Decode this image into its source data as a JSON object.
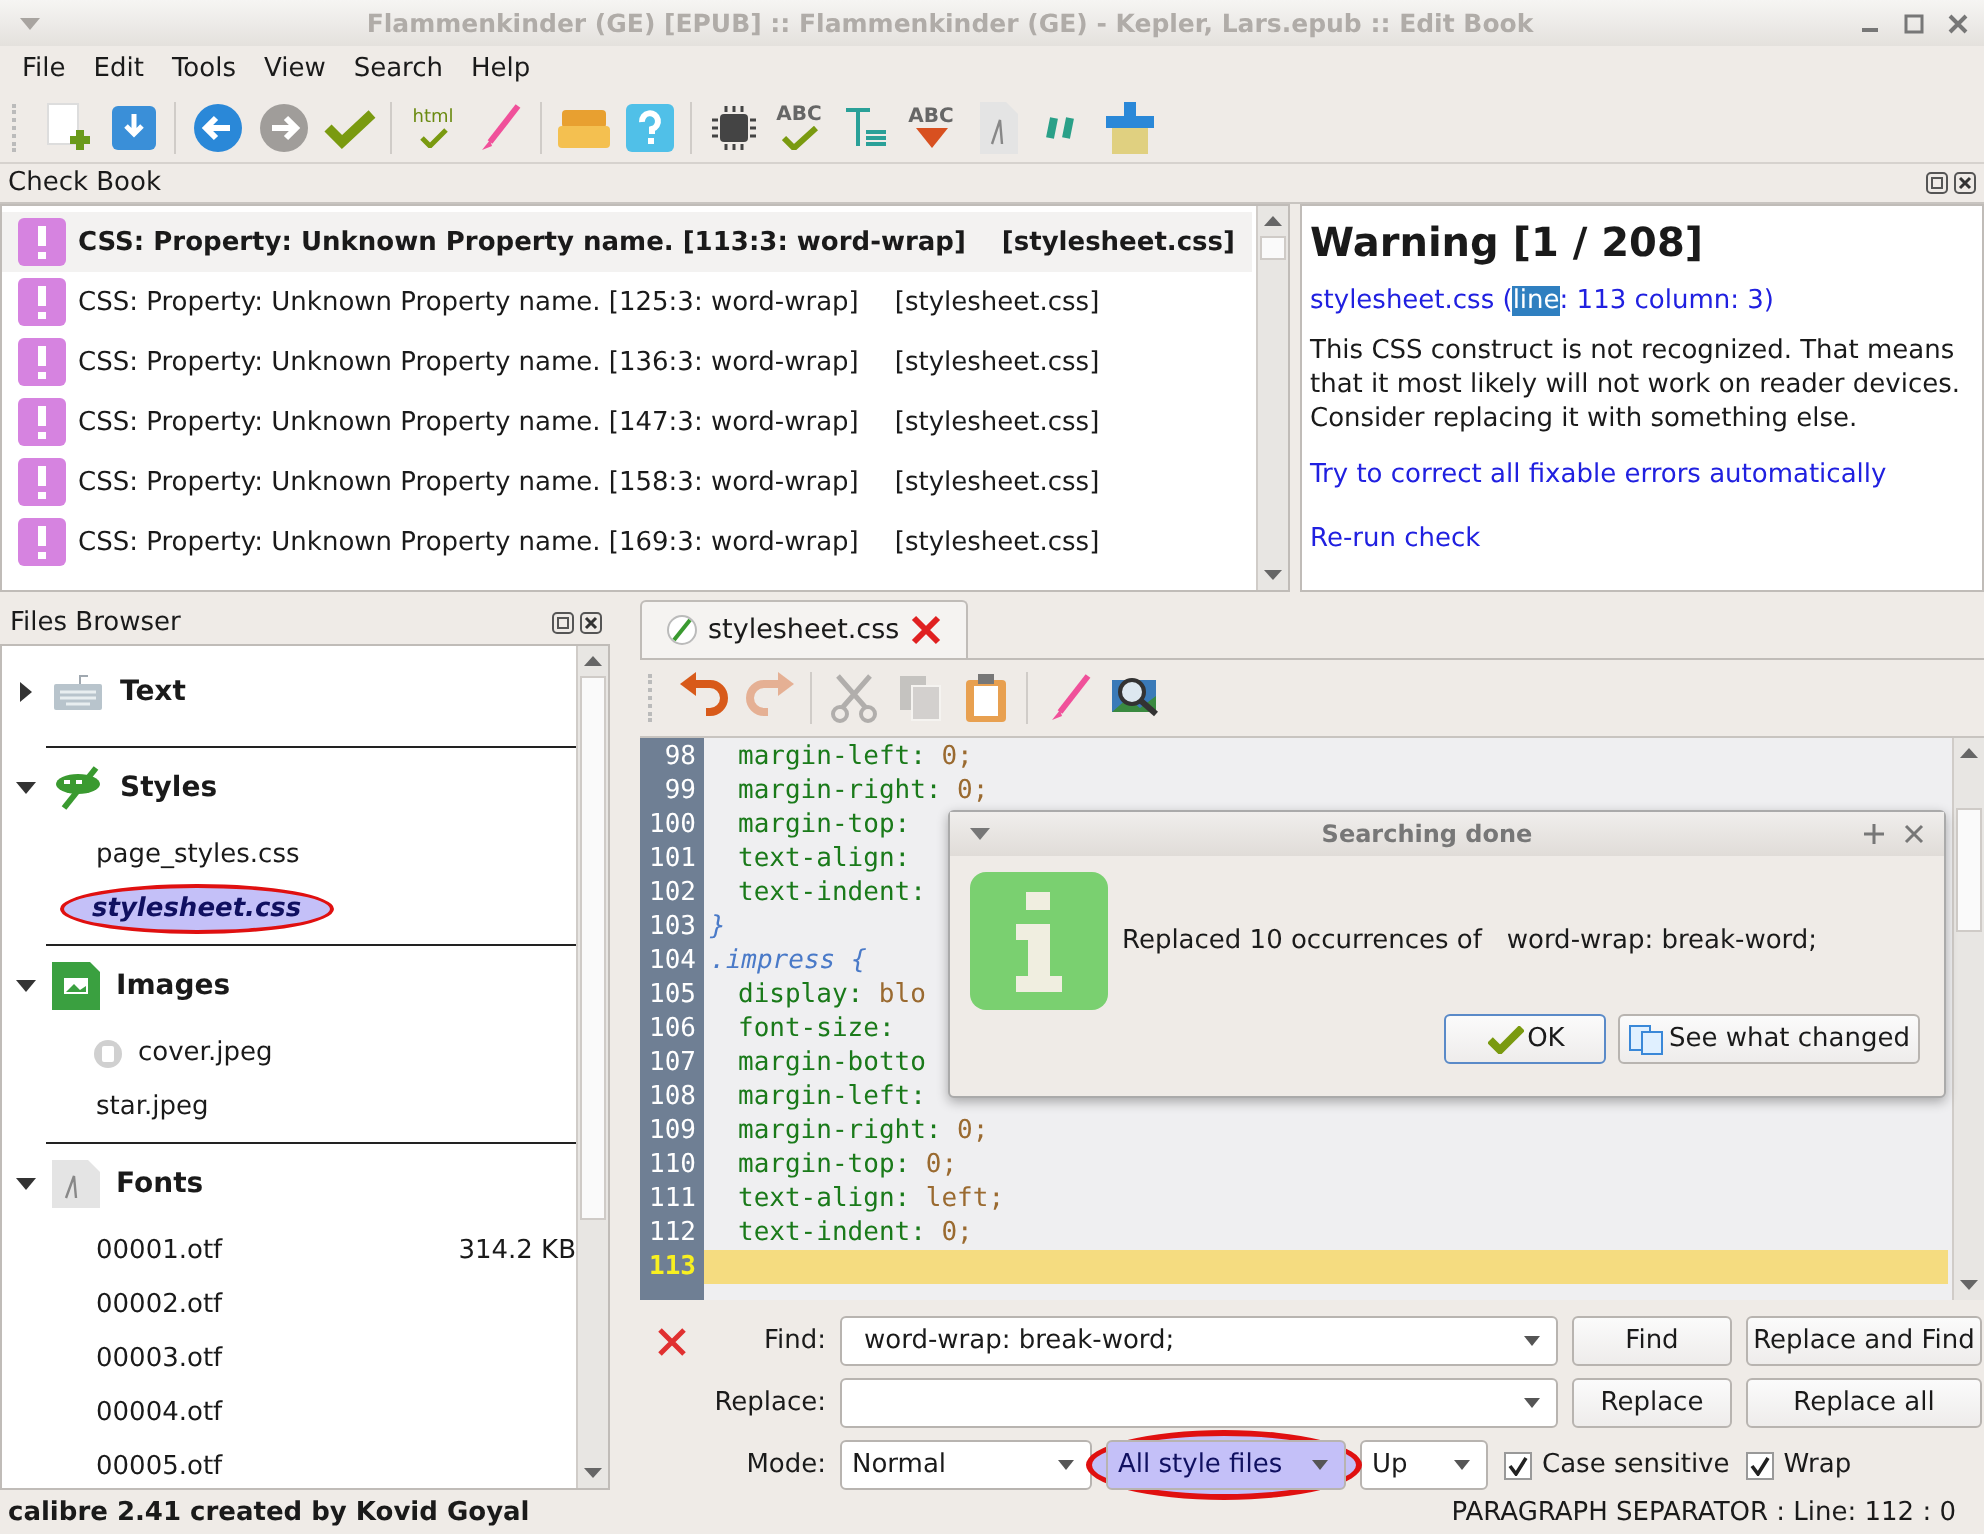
{
  "window": {
    "title": "Flammenkinder (GE) [EPUB] :: Flammenkinder (GE) - Kepler, Lars.epub :: Edit Book"
  },
  "menu": [
    "File",
    "Edit",
    "Tools",
    "View",
    "Search",
    "Help"
  ],
  "toolbar": [
    {
      "kind": "new-file"
    },
    {
      "kind": "save"
    },
    {
      "kind": "separator"
    },
    {
      "kind": "back"
    },
    {
      "kind": "forward"
    },
    {
      "kind": "check"
    },
    {
      "kind": "separator"
    },
    {
      "kind": "html-check",
      "text": "html"
    },
    {
      "kind": "brush"
    },
    {
      "kind": "separator"
    },
    {
      "kind": "box"
    },
    {
      "kind": "help"
    },
    {
      "kind": "separator"
    },
    {
      "kind": "chip"
    },
    {
      "kind": "spell-check",
      "text": "ABC"
    },
    {
      "kind": "text-format"
    },
    {
      "kind": "spell-replace",
      "text": "ABC"
    },
    {
      "kind": "font-doc"
    },
    {
      "kind": "quotes"
    },
    {
      "kind": "paint"
    }
  ],
  "check_book": {
    "title": "Check Book",
    "items": [
      {
        "message": "CSS: Property: Unknown Property name. [113:3: word-wrap]",
        "file": "[stylesheet.css]",
        "selected": true
      },
      {
        "message": "CSS: Property: Unknown Property name. [125:3: word-wrap]",
        "file": "[stylesheet.css]",
        "selected": false
      },
      {
        "message": "CSS: Property: Unknown Property name. [136:3: word-wrap]",
        "file": "[stylesheet.css]",
        "selected": false
      },
      {
        "message": "CSS: Property: Unknown Property name. [147:3: word-wrap]",
        "file": "[stylesheet.css]",
        "selected": false
      },
      {
        "message": "CSS: Property: Unknown Property name. [158:3: word-wrap]",
        "file": "[stylesheet.css]",
        "selected": false
      },
      {
        "message": "CSS: Property: Unknown Property name. [169:3: word-wrap]",
        "file": "[stylesheet.css]",
        "selected": false
      }
    ],
    "details": {
      "title": "Warning [1 / 208]",
      "location": {
        "before": "stylesheet.css (",
        "highlight": "line",
        "after": ": 113 column: 3)"
      },
      "description": "This CSS construct is not recognized. That means that it most likely will not work on reader devices. Consider replacing it with something else.",
      "links": [
        "Try to correct all fixable errors automatically",
        "Re-run check"
      ]
    }
  },
  "files_browser": {
    "title": "Files Browser",
    "sections": [
      {
        "name": "Text",
        "kind": "keyboard",
        "expanded": false
      },
      {
        "name": "Styles",
        "kind": "styles",
        "expanded": true,
        "children": [
          {
            "name": "page_styles.css",
            "selected": false
          },
          {
            "name": "stylesheet.css",
            "selected": true
          }
        ]
      },
      {
        "name": "Images",
        "kind": "images",
        "expanded": true,
        "children": [
          {
            "name": "cover.jpeg",
            "thumbnail": true,
            "selected": false
          },
          {
            "name": "star.jpeg",
            "selected": false
          }
        ]
      },
      {
        "name": "Fonts",
        "kind": "fonts",
        "expanded": true,
        "children": [
          {
            "name": "00001.otf",
            "size": "314.2 KB",
            "selected": false
          },
          {
            "name": "00002.otf",
            "selected": false
          },
          {
            "name": "00003.otf",
            "selected": false
          },
          {
            "name": "00004.otf",
            "selected": false
          },
          {
            "name": "00005.otf",
            "selected": false
          }
        ]
      }
    ]
  },
  "editor": {
    "tab": "stylesheet.css",
    "toolbar": [
      {
        "kind": "undo",
        "disabled": false
      },
      {
        "kind": "redo",
        "disabled": true
      },
      {
        "kind": "separator"
      },
      {
        "kind": "cut",
        "disabled": true
      },
      {
        "kind": "copy",
        "disabled": true
      },
      {
        "kind": "paste",
        "disabled": false
      },
      {
        "kind": "separator"
      },
      {
        "kind": "brush",
        "disabled": false
      },
      {
        "kind": "image-search",
        "disabled": false
      }
    ],
    "lines": [
      {
        "number": "98",
        "kind": "decl",
        "property": "margin-left:",
        "value": "0;",
        "current": false
      },
      {
        "number": "99",
        "kind": "decl",
        "property": "margin-right:",
        "value": "0;",
        "current": false
      },
      {
        "number": "100",
        "kind": "decl",
        "property": "margin-top:",
        "current": false
      },
      {
        "number": "101",
        "kind": "decl",
        "property": "text-align:",
        "current": false
      },
      {
        "number": "102",
        "kind": "decl",
        "property": "text-indent:",
        "current": false
      },
      {
        "number": "103",
        "kind": "brace",
        "text": "}",
        "current": false
      },
      {
        "number": "104",
        "kind": "selector",
        "text": ".impress {",
        "current": false
      },
      {
        "number": "105",
        "kind": "decl",
        "property": "display:",
        "value": "blo",
        "current": false
      },
      {
        "number": "106",
        "kind": "decl",
        "property": "font-size:",
        "current": false
      },
      {
        "number": "107",
        "kind": "decl",
        "property": "margin-botto",
        "current": false
      },
      {
        "number": "108",
        "kind": "decl",
        "property": "margin-left:",
        "current": false
      },
      {
        "number": "109",
        "kind": "decl",
        "property": "margin-right:",
        "value": "0;",
        "current": false
      },
      {
        "number": "110",
        "kind": "decl",
        "property": "margin-top:",
        "value": "0;",
        "current": false
      },
      {
        "number": "111",
        "kind": "decl",
        "property": "text-align:",
        "value": "left;",
        "current": false
      },
      {
        "number": "112",
        "kind": "decl",
        "property": "text-indent:",
        "value": "0;",
        "current": false
      },
      {
        "number": "113",
        "kind": "blank",
        "current": true
      }
    ]
  },
  "dialog": {
    "title": "Searching done",
    "message": "Replaced 10 occurrences of   word-wrap: break-word;",
    "buttons": [
      {
        "label": "OK",
        "default": true
      },
      {
        "label": "See what changed",
        "default": false
      }
    ]
  },
  "find": {
    "find_label": "Find:",
    "find_value": "word-wrap: break-word;",
    "replace_label": "Replace:",
    "mode_label": "Mode:",
    "mode": "Normal",
    "scope": "All style files",
    "scope_circled": true,
    "direction": "Up",
    "buttons": [
      "Find",
      "Replace and Find",
      "Replace",
      "Replace all"
    ],
    "checks": [
      {
        "label": "Case sensitive",
        "checked": true
      },
      {
        "label": "Wrap",
        "checked": true
      }
    ]
  },
  "status_bar": {
    "left": "calibre 2.41 created by Kovid Goyal",
    "right": "PARAGRAPH SEPARATOR : Line: 112 : 0"
  }
}
